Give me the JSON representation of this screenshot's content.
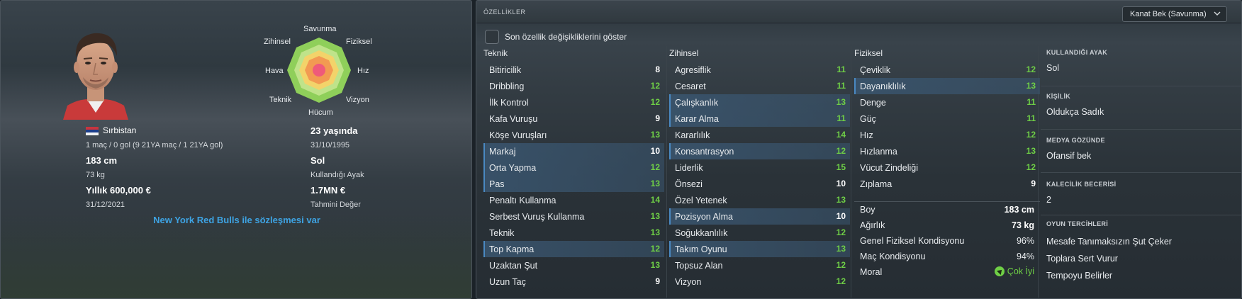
{
  "player": {
    "nationality": "Sırbistan",
    "caps": "1 maç / 0 gol (9 21YA maç / 1 21YA gol)",
    "age": "23 yaşında",
    "birth_date": "31/10/1995",
    "height": "183 cm",
    "weight": "73 kg",
    "preferred_foot": "Sol",
    "preferred_foot_label": "Kullandığı Ayak",
    "wage": "Yıllık 600,000 €",
    "contract_end": "31/12/2021",
    "value": "1.7MN €",
    "value_label": "Tahmini Değer",
    "contract_link": "New York Red Bulls ile sözleşmesi var"
  },
  "radar": {
    "labels": {
      "top": "Savunma",
      "top_right": "Fiziksel",
      "right": "Hız",
      "bottom_right": "Vizyon",
      "bottom": "Hücum",
      "bottom_left": "Teknik",
      "left": "Hava",
      "top_left": "Zihinsel"
    }
  },
  "panel": {
    "title": "ÖZELLİKLER",
    "role_select": "Kanat Bek (Savunma)",
    "toggle_label": "Son özellik değişikliklerini göster"
  },
  "columns": {
    "technical": "Teknik",
    "mental": "Zihinsel",
    "physical": "Fiziksel"
  },
  "technical": [
    {
      "name": "Bitiricilik",
      "value": "8",
      "hl": false,
      "color": "w"
    },
    {
      "name": "Dribbling",
      "value": "12",
      "hl": false,
      "color": "g"
    },
    {
      "name": "İlk Kontrol",
      "value": "12",
      "hl": false,
      "color": "g"
    },
    {
      "name": "Kafa Vuruşu",
      "value": "9",
      "hl": false,
      "color": "w"
    },
    {
      "name": "Köşe Vuruşları",
      "value": "13",
      "hl": false,
      "color": "g"
    },
    {
      "name": "Markaj",
      "value": "10",
      "hl": true,
      "color": "w"
    },
    {
      "name": "Orta Yapma",
      "value": "12",
      "hl": true,
      "color": "g"
    },
    {
      "name": "Pas",
      "value": "13",
      "hl": true,
      "color": "g"
    },
    {
      "name": "Penaltı Kullanma",
      "value": "14",
      "hl": false,
      "color": "g"
    },
    {
      "name": "Serbest Vuruş Kullanma",
      "value": "13",
      "hl": false,
      "color": "g"
    },
    {
      "name": "Teknik",
      "value": "13",
      "hl": false,
      "color": "g"
    },
    {
      "name": "Top Kapma",
      "value": "12",
      "hl": true,
      "color": "g"
    },
    {
      "name": "Uzaktan Şut",
      "value": "13",
      "hl": false,
      "color": "g"
    },
    {
      "name": "Uzun Taç",
      "value": "9",
      "hl": false,
      "color": "w"
    }
  ],
  "mental": [
    {
      "name": "Agresiflik",
      "value": "11",
      "hl": false,
      "color": "g"
    },
    {
      "name": "Cesaret",
      "value": "11",
      "hl": false,
      "color": "g"
    },
    {
      "name": "Çalışkanlık",
      "value": "13",
      "hl": true,
      "color": "g"
    },
    {
      "name": "Karar Alma",
      "value": "11",
      "hl": true,
      "color": "g"
    },
    {
      "name": "Kararlılık",
      "value": "14",
      "hl": false,
      "color": "g"
    },
    {
      "name": "Konsantrasyon",
      "value": "12",
      "hl": true,
      "color": "g"
    },
    {
      "name": "Liderlik",
      "value": "15",
      "hl": false,
      "color": "g"
    },
    {
      "name": "Önsezi",
      "value": "10",
      "hl": false,
      "color": "w"
    },
    {
      "name": "Özel Yetenek",
      "value": "13",
      "hl": false,
      "color": "g"
    },
    {
      "name": "Pozisyon Alma",
      "value": "10",
      "hl": true,
      "color": "w"
    },
    {
      "name": "Soğukkanlılık",
      "value": "12",
      "hl": false,
      "color": "g"
    },
    {
      "name": "Takım Oyunu",
      "value": "13",
      "hl": true,
      "color": "g"
    },
    {
      "name": "Topsuz Alan",
      "value": "12",
      "hl": false,
      "color": "g"
    },
    {
      "name": "Vizyon",
      "value": "12",
      "hl": false,
      "color": "g"
    }
  ],
  "physical": [
    {
      "name": "Çeviklik",
      "value": "12",
      "hl": false,
      "color": "g"
    },
    {
      "name": "Dayanıklılık",
      "value": "13",
      "hl": true,
      "color": "g"
    },
    {
      "name": "Denge",
      "value": "11",
      "hl": false,
      "color": "g"
    },
    {
      "name": "Güç",
      "value": "11",
      "hl": false,
      "color": "g"
    },
    {
      "name": "Hız",
      "value": "12",
      "hl": false,
      "color": "g"
    },
    {
      "name": "Hızlanma",
      "value": "13",
      "hl": false,
      "color": "g"
    },
    {
      "name": "Vücut Zindeliği",
      "value": "12",
      "hl": false,
      "color": "g"
    },
    {
      "name": "Zıplama",
      "value": "9",
      "hl": false,
      "color": "w"
    }
  ],
  "physical_extra": {
    "height_label": "Boy",
    "height": "183 cm",
    "weight_label": "Ağırlık",
    "weight": "73 kg",
    "fitness_label": "Genel Fiziksel Kondisyonu",
    "fitness": "96%",
    "match_label": "Maç Kondisyonu",
    "match": "94%",
    "morale_label": "Moral",
    "morale": "Çok İyi"
  },
  "side": {
    "foot_head": "KULLANDIĞI AYAK",
    "foot": "Sol",
    "personality_head": "KİŞİLİK",
    "personality": "Oldukça Sadık",
    "media_head": "MEDYA GÖZÜNDE",
    "media": "Ofansif bek",
    "gk_head": "KALECİLİK BECERİSİ",
    "gk": "2",
    "prefs_head": "OYUN TERCİHLERİ",
    "prefs": [
      "Mesafe Tanımaksızın Şut Çeker",
      "Toplara Sert Vurur",
      "Tempoyu Belirler"
    ]
  },
  "colors": {
    "green_value": "#6fcf46",
    "link_blue": "#3ea3e3",
    "highlight_row": "#3a5670"
  }
}
